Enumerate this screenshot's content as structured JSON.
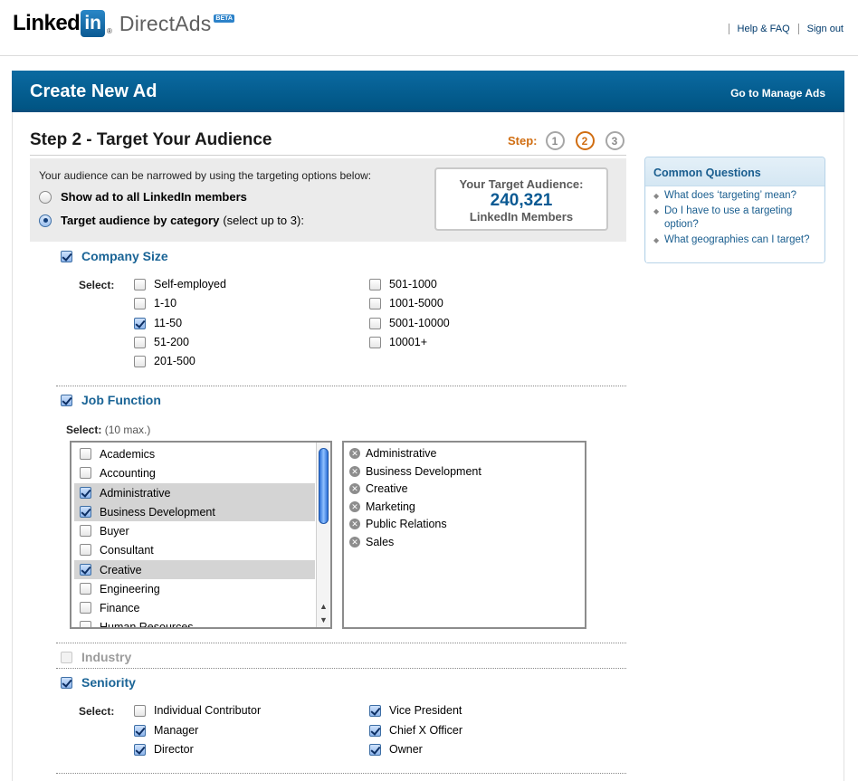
{
  "topbar": {
    "logo_linked": "Linked",
    "logo_in": "in",
    "logo_reg": "®",
    "logo_product": "DirectAds",
    "logo_beta": "BETA",
    "links": [
      "Help & FAQ",
      "Sign out"
    ]
  },
  "header": {
    "title": "Create New Ad",
    "manage_link": "Go to Manage Ads"
  },
  "step": {
    "title": "Step 2 - Target Your Audience",
    "label": "Step:",
    "steps": [
      "1",
      "2",
      "3"
    ],
    "current": 2
  },
  "audience": {
    "intro": "Your audience can be narrowed by using the targeting options below:",
    "option_all": "Show ad to all LinkedIn members",
    "option_category": "Target audience by category",
    "option_category_note": "(select up to 3):",
    "selected_option": "category",
    "target_title": "Your Target Audience:",
    "target_count": "240,321",
    "target_unit": "LinkedIn Members"
  },
  "company_size": {
    "title": "Company Size",
    "checked": true,
    "select_label": "Select:",
    "options": [
      {
        "label": "Self-employed",
        "checked": false
      },
      {
        "label": "1-10",
        "checked": false
      },
      {
        "label": "11-50",
        "checked": true
      },
      {
        "label": "51-200",
        "checked": false
      },
      {
        "label": "201-500",
        "checked": false
      },
      {
        "label": "501-1000",
        "checked": false
      },
      {
        "label": "1001-5000",
        "checked": false
      },
      {
        "label": "5001-10000",
        "checked": false
      },
      {
        "label": "10001+",
        "checked": false
      }
    ]
  },
  "job_function": {
    "title": "Job Function",
    "checked": true,
    "select_label": "Select:",
    "select_note": "(10 max.)",
    "list": [
      {
        "label": "Academics",
        "checked": false
      },
      {
        "label": "Accounting",
        "checked": false
      },
      {
        "label": "Administrative",
        "checked": true
      },
      {
        "label": "Business Development",
        "checked": true
      },
      {
        "label": "Buyer",
        "checked": false
      },
      {
        "label": "Consultant",
        "checked": false
      },
      {
        "label": "Creative",
        "checked": true
      },
      {
        "label": "Engineering",
        "checked": false
      },
      {
        "label": "Finance",
        "checked": false
      },
      {
        "label": "Human Resources",
        "checked": false
      }
    ],
    "chosen": [
      "Administrative",
      "Business Development",
      "Creative",
      "Marketing",
      "Public Relations",
      "Sales"
    ]
  },
  "industry": {
    "title": "Industry",
    "checked": false,
    "disabled": true
  },
  "seniority": {
    "title": "Seniority",
    "checked": true,
    "select_label": "Select:",
    "options": [
      {
        "label": "Individual Contributor",
        "checked": false
      },
      {
        "label": "Manager",
        "checked": true
      },
      {
        "label": "Director",
        "checked": true
      },
      {
        "label": "Vice President",
        "checked": true
      },
      {
        "label": "Chief X Officer",
        "checked": true
      },
      {
        "label": "Owner",
        "checked": true
      }
    ]
  },
  "sidebar": {
    "title": "Common Questions",
    "questions": [
      "What does ‘targeting’ mean?",
      "Do I have to use a targeting option?",
      "What geographies can I target?"
    ]
  },
  "colors": {
    "header_blue": "#005d93",
    "link_blue": "#1a6496",
    "step_orange": "#d06d11"
  }
}
